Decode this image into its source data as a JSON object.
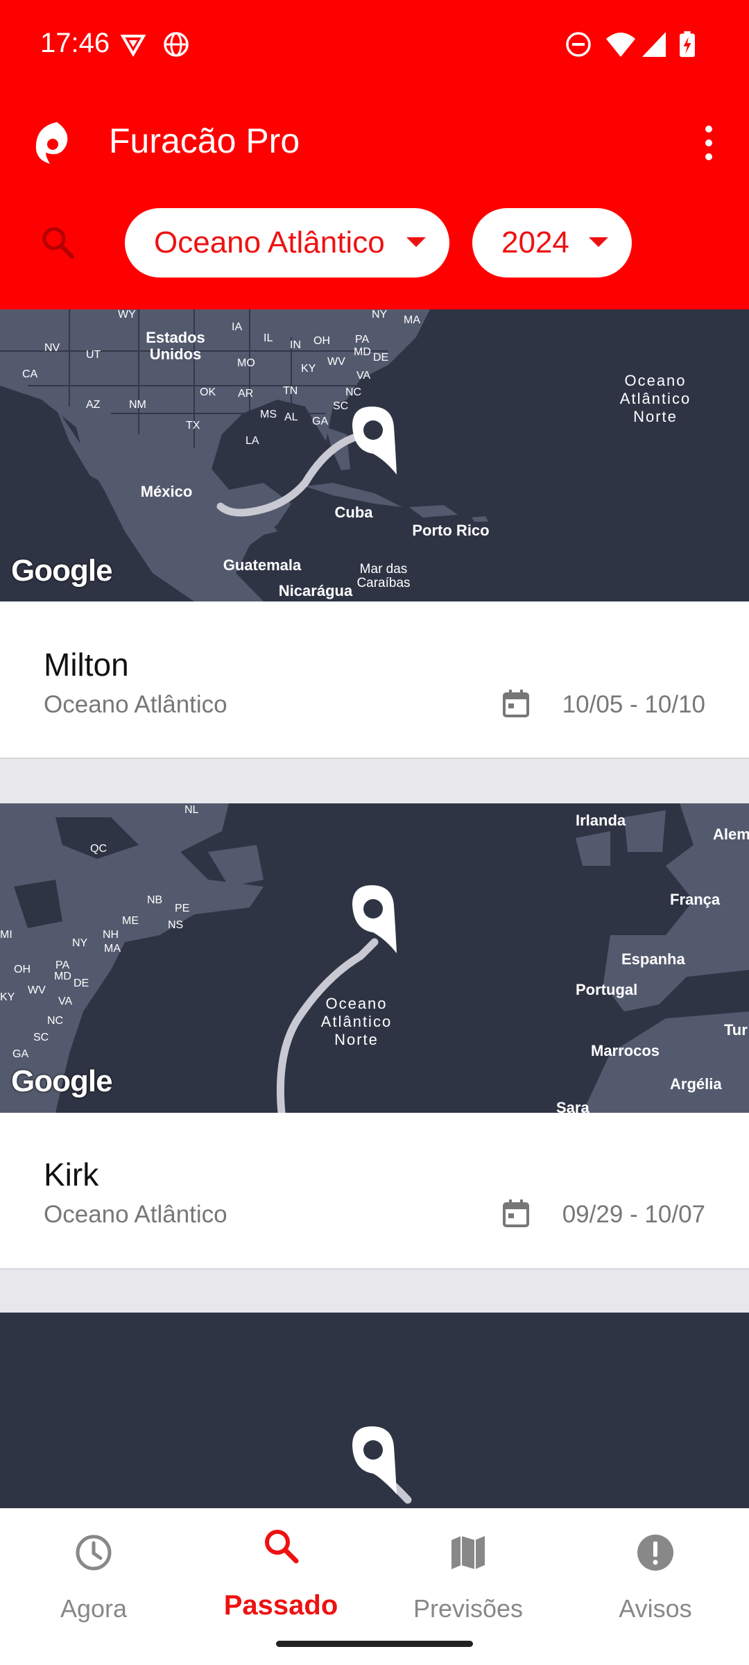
{
  "status_bar": {
    "time": "17:46"
  },
  "app": {
    "title": "Furacão Pro"
  },
  "filters": {
    "basin": "Oceano Atlântico",
    "year": "2024"
  },
  "storms": [
    {
      "name": "Milton",
      "basin": "Oceano Atlântico",
      "dates": "10/05 - 10/10",
      "map_labels": [
        "Estados Unidos",
        "México",
        "Cuba",
        "Porto Rico",
        "Guatemala",
        "Nicarágua",
        "Mar das Caraíbas",
        "Oceano Atlântico Norte",
        "NV",
        "UT",
        "CA",
        "AZ",
        "NM",
        "OK",
        "TX",
        "AR",
        "LA",
        "MS",
        "AL",
        "GA",
        "SC",
        "NC",
        "TN",
        "KY",
        "WV",
        "VA",
        "MO",
        "IL",
        "IN",
        "OH",
        "PA",
        "MD",
        "DE",
        "NY",
        "MA",
        "IA",
        "WY"
      ]
    },
    {
      "name": "Kirk",
      "basin": "Oceano Atlântico",
      "dates": "09/29 - 10/07",
      "map_labels": [
        "Irlanda",
        "França",
        "Espanha",
        "Portugal",
        "Marrocos",
        "Argélia",
        "Oceano Atlântico Norte",
        "QC",
        "NL",
        "NB",
        "PE",
        "NS",
        "ME",
        "NH",
        "MA",
        "NY",
        "MI",
        "OH",
        "PA",
        "MD",
        "DE",
        "KY",
        "WV",
        "VA",
        "NC",
        "SC",
        "GA",
        "Alem",
        "Tur",
        "Sara"
      ]
    }
  ],
  "map_attribution": "Google",
  "nav": {
    "items": [
      {
        "label": "Agora",
        "icon": "clock-icon"
      },
      {
        "label": "Passado",
        "icon": "search-icon"
      },
      {
        "label": "Previsões",
        "icon": "map-icon"
      },
      {
        "label": "Avisos",
        "icon": "alert-icon"
      }
    ],
    "active": "Passado"
  },
  "colors": {
    "brand": "#ff0000",
    "map_bg": "#2f3445",
    "land": "#545a6e",
    "track": "#c8c9d2"
  }
}
